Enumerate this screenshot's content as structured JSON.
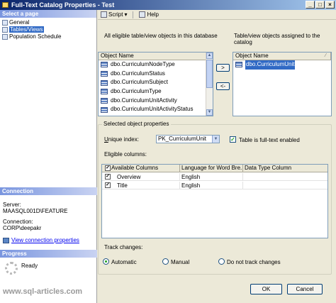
{
  "window": {
    "title": "Full-Text Catalog Properties - Test",
    "buttons": {
      "minimize": "_",
      "maximize": "□",
      "close": "×"
    }
  },
  "left": {
    "select_page_header": "Select a page",
    "pages": [
      "General",
      "Tables/Views",
      "Population Schedule"
    ],
    "connection_header": "Connection",
    "server_label": "Server:",
    "server_value": "MAASQL001D\\FEATURE",
    "connection_label": "Connection:",
    "connection_value": "CORP\\deepakr",
    "view_connection_link": "View connection properties",
    "progress_header": "Progress",
    "progress_status": "Ready"
  },
  "toolbar": {
    "script_label": "Script",
    "help_label": "Help"
  },
  "eligible": {
    "label": "All eligible table/view objects in this database",
    "column_header": "Object Name",
    "items": [
      "dbo.CurriculumNodeType",
      "dbo.CurriculumStatus",
      "dbo.CurriculumSubject",
      "dbo.CurriculumType",
      "dbo.CurriculumUnitActivity",
      "dbo.CurriculumUnitActivityStatus"
    ]
  },
  "assigned": {
    "label_line1": "Table/view objects assigned to the",
    "label_line2": "catalog",
    "column_header": "Object Name",
    "items": [
      "dbo.CurriculumUnit"
    ]
  },
  "move": {
    "add": ">",
    "remove": "<-"
  },
  "selected": {
    "group_title": "Selected object properties",
    "unique_index_label": "Unique index:",
    "unique_index_value": "PK_CurriculumUnit",
    "fulltext_label": "Table is full-text enabled",
    "eligible_columns_label": "Eligible columns:",
    "columns": {
      "headers": [
        "Available Columns",
        "Language for Word Bre...",
        "Data Type Column"
      ],
      "rows": [
        {
          "name": "Overview",
          "language": "English",
          "checked": "✓"
        },
        {
          "name": "Title",
          "language": "English",
          "checked": "✓"
        }
      ]
    },
    "track_changes_label": "Track changes:",
    "track_options": [
      "Automatic",
      "Manual",
      "Do not track changes"
    ]
  },
  "footer": {
    "ok": "OK",
    "cancel": "Cancel"
  },
  "watermark": "www.sql-articles.com"
}
